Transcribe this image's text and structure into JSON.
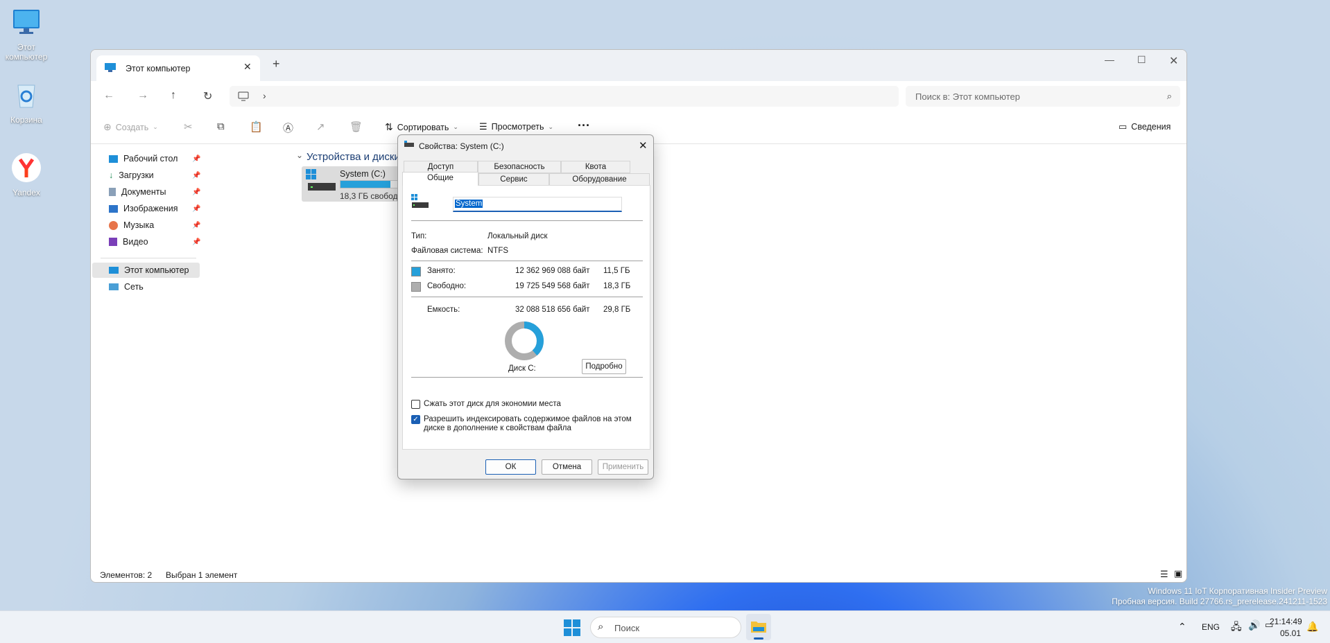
{
  "desktop": {
    "icons": [
      {
        "label": "Этот компьютер"
      },
      {
        "label": "Корзина"
      },
      {
        "label": "Yandex"
      }
    ],
    "watermark": {
      "line1": "Windows 11 IoT Корпоративная Insider Preview",
      "line2": "Пробная версия. Build 27766.rs_prerelease.241211-1523"
    }
  },
  "explorer": {
    "tab_title": "Этот компьютер",
    "new_tab": "+",
    "search_placeholder": "Поиск в: Этот компьютер",
    "toolbar": {
      "create": "Создать",
      "sort": "Сортировать",
      "view": "Просмотреть",
      "more": "···",
      "details": "Сведения"
    },
    "sidebar": {
      "pinned": [
        {
          "label": "Рабочий стол"
        },
        {
          "label": "Загрузки"
        },
        {
          "label": "Документы"
        },
        {
          "label": "Изображения"
        },
        {
          "label": "Музыка"
        },
        {
          "label": "Видео"
        }
      ],
      "this_pc": "Этот компьютер",
      "network": "Сеть"
    },
    "section_title": "Устройства и диски",
    "drive": {
      "name": "System (C:)",
      "free_text": "18,3 ГБ свободно из 29,8 ГБ",
      "used_fraction": 0.385
    },
    "status": {
      "items": "Элементов: 2",
      "selected": "Выбран 1 элемент"
    }
  },
  "dialog": {
    "title": "Свойства: System (C:)",
    "tabs_row1": [
      "Доступ",
      "Безопасность",
      "Квота"
    ],
    "tabs_row2": [
      "Общие",
      "Сервис",
      "Оборудование"
    ],
    "name_value": "System",
    "type_label": "Тип:",
    "type_value": "Локальный диск",
    "fs_label": "Файловая система:",
    "fs_value": "NTFS",
    "used_label": "Занято:",
    "used_bytes": "12 362 969 088 байт",
    "used_gb": "11,5 ГБ",
    "free_label": "Свободно:",
    "free_bytes": "19 725 549 568 байт",
    "free_gb": "18,3 ГБ",
    "cap_label": "Емкость:",
    "cap_bytes": "32 088 518 656 байт",
    "cap_gb": "29,8 ГБ",
    "disk_label": "Диск C:",
    "details_btn": "Подробно",
    "compress_label": "Сжать этот диск для экономии места",
    "compress_checked": false,
    "index_label_1": "Разрешить индексировать содержимое файлов на этом",
    "index_label_2": "диске в дополнение к свойствам файла",
    "index_checked": true,
    "ok": "ОК",
    "cancel": "Отмена",
    "apply": "Применить",
    "used_color": "#26a0da",
    "free_color": "#aeaeae",
    "used_fraction": 0.385
  },
  "taskbar": {
    "search_placeholder": "Поиск",
    "lang": "ENG",
    "time": "21:14:49",
    "date": "05.01"
  }
}
